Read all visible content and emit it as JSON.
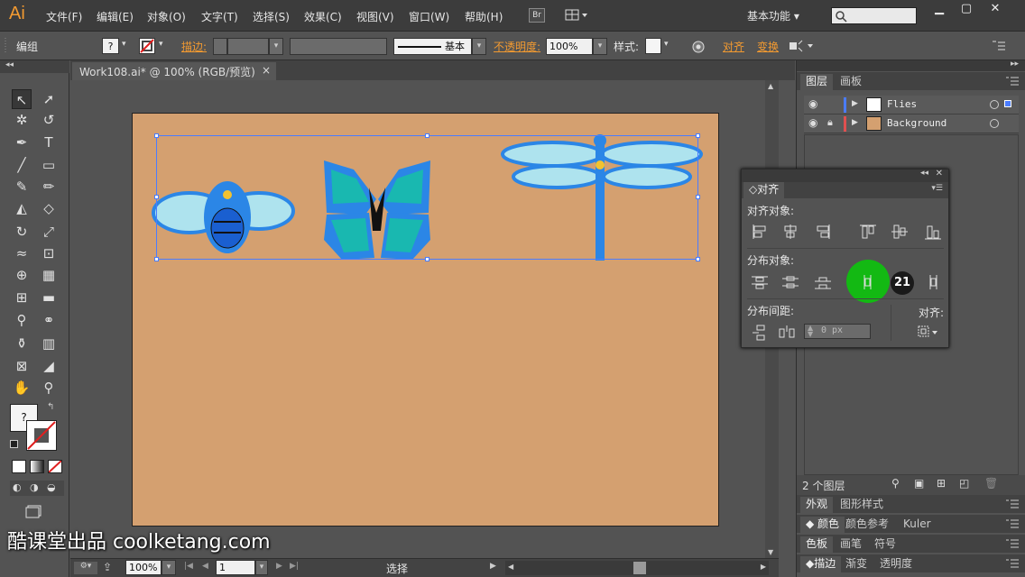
{
  "app": {
    "logo": "Ai"
  },
  "menu": [
    "文件(F)",
    "编辑(E)",
    "对象(O)",
    "文字(T)",
    "选择(S)",
    "效果(C)",
    "视图(V)",
    "窗口(W)",
    "帮助(H)"
  ],
  "bridge_label": "Br",
  "workspace": "基本功能",
  "control": {
    "selection_label": "编组",
    "stroke_label": "描边:",
    "style_preset": "基本",
    "opacity_label": "不透明度:",
    "opacity_value": "100%",
    "style_label": "样式:",
    "align_link": "对齐",
    "transform_link": "变换",
    "fill_icon": "?"
  },
  "document": {
    "tab_title": "Work108.ai* @ 100% (RGB/预览)",
    "close": "×"
  },
  "layers": {
    "tabs": [
      "图层",
      "画板"
    ],
    "items": [
      {
        "name": "Flies",
        "color": "#4a7cff"
      },
      {
        "name": "Background",
        "color": "#e05050"
      }
    ],
    "count": "2 个图层"
  },
  "align_panel": {
    "title": "对齐",
    "align_objects": "对齐对象:",
    "distribute_objects": "分布对象:",
    "distribute_spacing": "分布间距:",
    "align_to": "对齐:",
    "spacing_value": "0 px",
    "step_badge": "21"
  },
  "lower_panels": [
    {
      "tabs": [
        "外观",
        "图形样式"
      ]
    },
    {
      "tabs": [
        "颜色",
        "颜色参考",
        "Kuler"
      ]
    },
    {
      "tabs": [
        "色板",
        "画笔",
        "符号"
      ]
    },
    {
      "tabs": [
        "描边",
        "渐变",
        "透明度"
      ]
    }
  ],
  "status": {
    "zoom": "100%",
    "page": "1",
    "tool": "选择"
  },
  "watermark": "酷课堂出品 coolketang.com",
  "colors": {
    "accent": "#f29a31",
    "artboard": "#d4a070",
    "selection": "#4a7cff",
    "highlight": "#13b913"
  }
}
